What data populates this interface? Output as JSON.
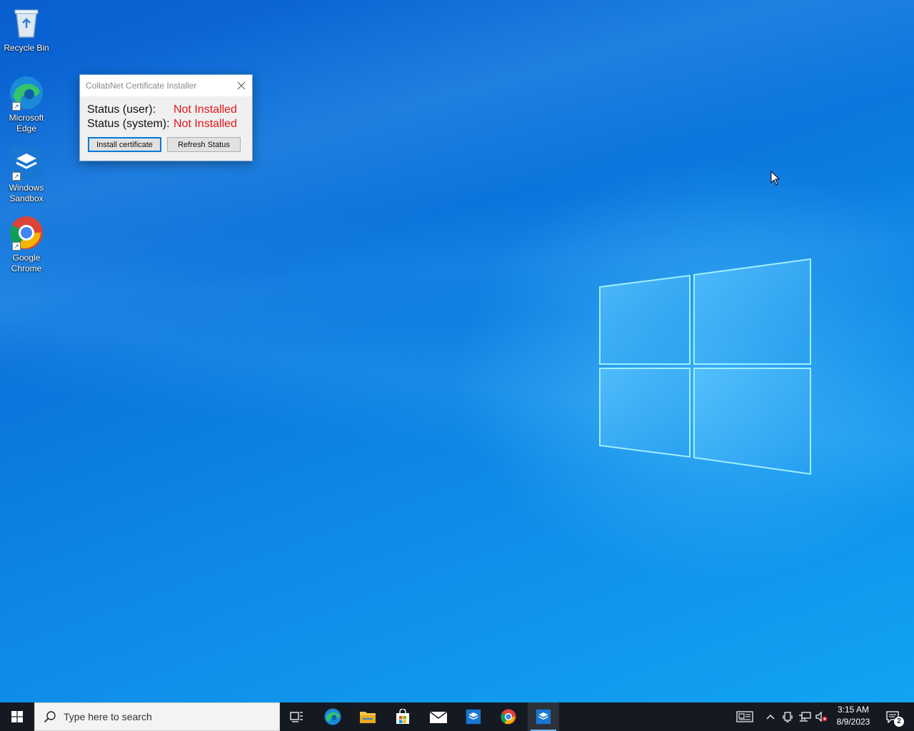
{
  "desktop": {
    "icons": [
      {
        "label": "Recycle Bin"
      },
      {
        "label": "Microsoft Edge"
      },
      {
        "label": "Windows Sandbox"
      },
      {
        "label": "Google Chrome"
      }
    ]
  },
  "dialog": {
    "title": "CollabNet Certificate Installer",
    "status_user_label": "Status (user):",
    "status_user_value": "Not Installed",
    "status_system_label": "Status (system):",
    "status_system_value": "Not Installed",
    "install_button": "Install certificate",
    "refresh_button": "Refresh Status",
    "status_color": "#e3141b"
  },
  "taskbar": {
    "search_placeholder": "Type here to search",
    "apps": [
      "task-view",
      "microsoft-edge",
      "file-explorer",
      "microsoft-store",
      "mail",
      "windows-sandbox",
      "google-chrome",
      "windows-sandbox-active"
    ],
    "clock_time": "3:15 AM",
    "clock_date": "8/9/2023",
    "notification_count": "2",
    "accent": "#76b9ed"
  }
}
